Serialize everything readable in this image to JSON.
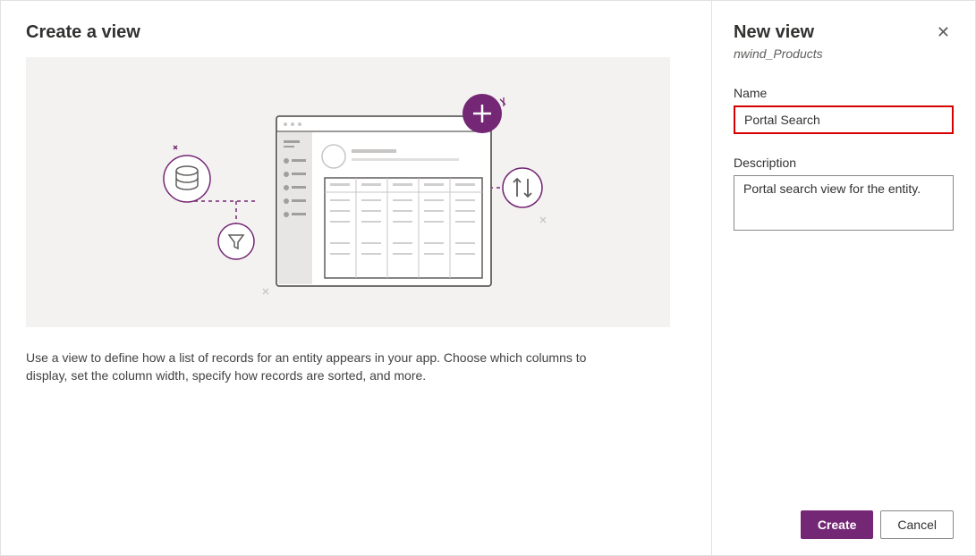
{
  "left": {
    "title": "Create a view",
    "description": "Use a view to define how a list of records for an entity appears in your app. Choose which columns to display, set the column width, specify how records are sorted, and more."
  },
  "right": {
    "title": "New view",
    "subtitle": "nwind_Products",
    "name_label": "Name",
    "name_value": "Portal Search",
    "desc_label": "Description",
    "desc_value": "Portal search view for the entity."
  },
  "buttons": {
    "create": "Create",
    "cancel": "Cancel"
  },
  "colors": {
    "accent": "#742774",
    "highlight_border": "#d60000"
  }
}
